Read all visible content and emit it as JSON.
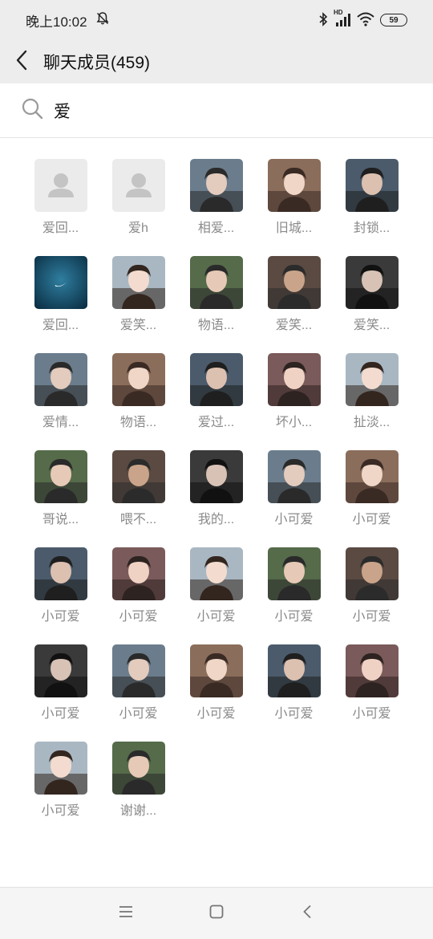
{
  "status": {
    "time": "晚上10:02",
    "network": "HD",
    "battery": "59"
  },
  "header": {
    "title": "聊天成员(459)"
  },
  "search": {
    "value": "爱"
  },
  "members": [
    {
      "name": "爱回...",
      "avatar": "default-avatar"
    },
    {
      "name": "爱h",
      "avatar": "default-avatar"
    },
    {
      "name": "相爱...",
      "avatar": "photo"
    },
    {
      "name": "旧城...",
      "avatar": "photo"
    },
    {
      "name": "封锁...",
      "avatar": "photo"
    },
    {
      "name": "爱回...",
      "avatar": "nike-logo"
    },
    {
      "name": "爱笑...",
      "avatar": "photo"
    },
    {
      "name": "物语...",
      "avatar": "photo"
    },
    {
      "name": "爱笑...",
      "avatar": "photo"
    },
    {
      "name": "爱笑...",
      "avatar": "photo"
    },
    {
      "name": "爱情...",
      "avatar": "photo"
    },
    {
      "name": "物语...",
      "avatar": "photo"
    },
    {
      "name": "爱过...",
      "avatar": "photo"
    },
    {
      "name": "坏小...",
      "avatar": "photo"
    },
    {
      "name": "扯淡...",
      "avatar": "photo"
    },
    {
      "name": "哥说...",
      "avatar": "photo"
    },
    {
      "name": "喂不...",
      "avatar": "photo"
    },
    {
      "name": "我的...",
      "avatar": "photo"
    },
    {
      "name": "小可爱",
      "avatar": "photo"
    },
    {
      "name": "小可爱",
      "avatar": "photo"
    },
    {
      "name": "小可爱",
      "avatar": "photo"
    },
    {
      "name": "小可爱",
      "avatar": "photo"
    },
    {
      "name": "小可爱",
      "avatar": "photo"
    },
    {
      "name": "小可爱",
      "avatar": "photo"
    },
    {
      "name": "小可爱",
      "avatar": "photo"
    },
    {
      "name": "小可爱",
      "avatar": "photo"
    },
    {
      "name": "小可爱",
      "avatar": "photo"
    },
    {
      "name": "小可爱",
      "avatar": "photo"
    },
    {
      "name": "小可爱",
      "avatar": "photo"
    },
    {
      "name": "小可爱",
      "avatar": "photo"
    },
    {
      "name": "小可爱",
      "avatar": "photo"
    },
    {
      "name": "谢谢...",
      "avatar": "photo"
    }
  ],
  "icons": {
    "back": "back-arrow-icon",
    "search": "search-icon",
    "bell_off": "bell-off-icon",
    "bluetooth": "bluetooth-icon",
    "signal": "signal-icon",
    "wifi": "wifi-icon",
    "menu": "menu-icon",
    "home": "home-icon",
    "nav_back": "nav-back-icon"
  }
}
